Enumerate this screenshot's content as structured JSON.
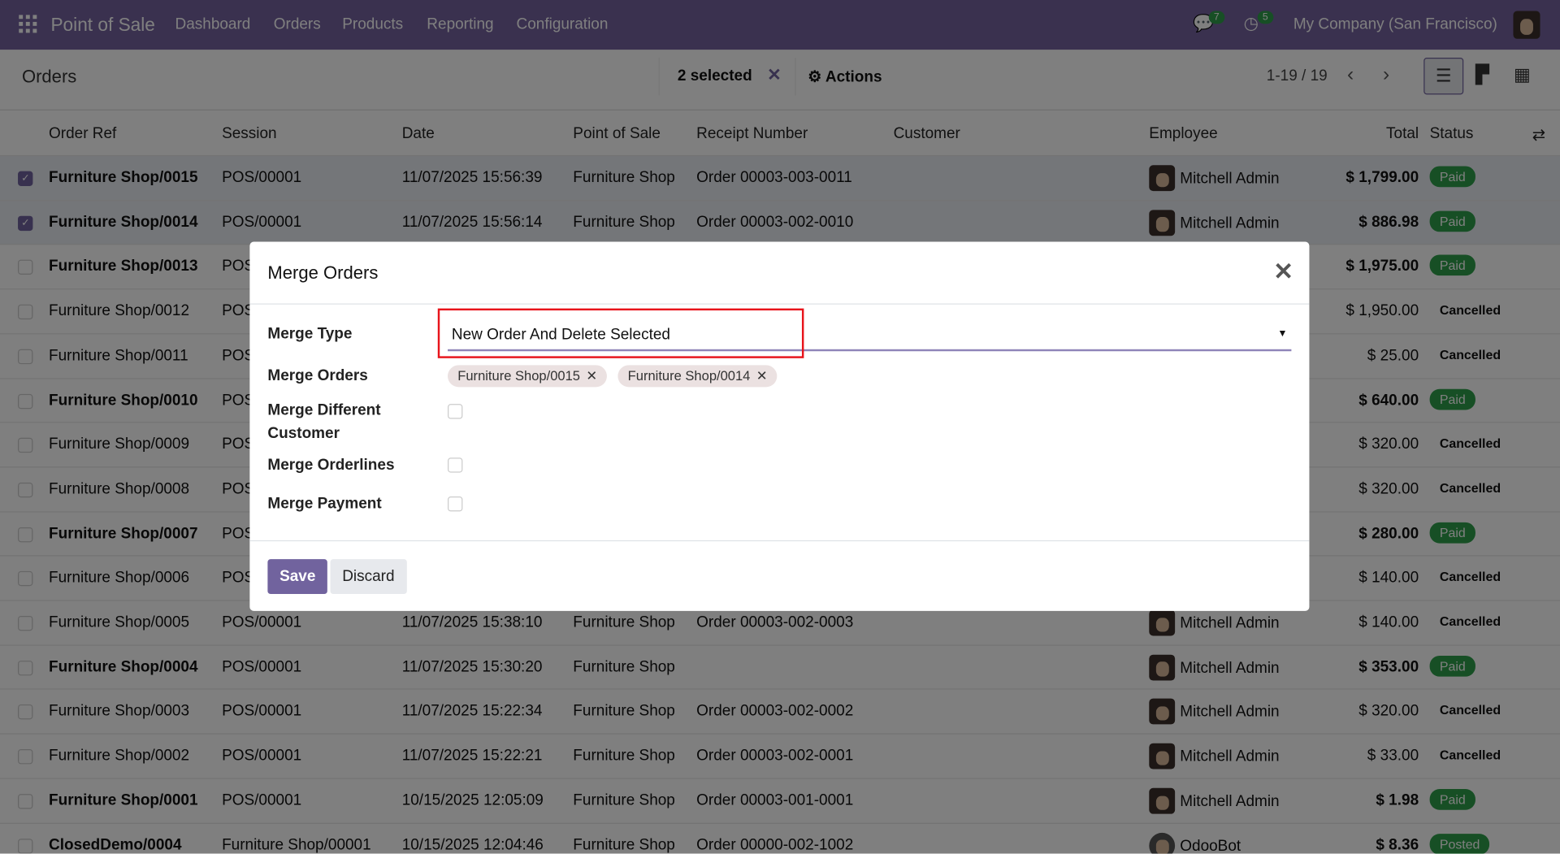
{
  "navbar": {
    "brand": "Point of Sale",
    "menu": [
      "Dashboard",
      "Orders",
      "Products",
      "Reporting",
      "Configuration"
    ],
    "messages_count": "7",
    "activities_count": "5",
    "company": "My Company (San Francisco)"
  },
  "control_panel": {
    "title": "Orders",
    "selected": "2 selected",
    "actions": "Actions",
    "pager": "1-19 / 19"
  },
  "columns": [
    "Order Ref",
    "Session",
    "Date",
    "Point of Sale",
    "Receipt Number",
    "Customer",
    "Employee",
    "Total",
    "Status"
  ],
  "rows": [
    {
      "ref": "Furniture Shop/0015",
      "session": "POS/00001",
      "date": "11/07/2025 15:56:39",
      "pos": "Furniture Shop",
      "receipt": "Order 00003-003-0011",
      "employee": "Mitchell Admin",
      "total": "$ 1,799.00",
      "status": "Paid",
      "checked": true
    },
    {
      "ref": "Furniture Shop/0014",
      "session": "POS/00001",
      "date": "11/07/2025 15:56:14",
      "pos": "Furniture Shop",
      "receipt": "Order 00003-002-0010",
      "employee": "Mitchell Admin",
      "total": "$ 886.98",
      "status": "Paid",
      "checked": true
    },
    {
      "ref": "Furniture Shop/0013",
      "session": "POS",
      "total": "$ 1,975.00",
      "status": "Paid"
    },
    {
      "ref": "Furniture Shop/0012",
      "session": "POS",
      "total": "$ 1,950.00",
      "status": "Cancelled"
    },
    {
      "ref": "Furniture Shop/0011",
      "session": "POS",
      "total": "$ 25.00",
      "status": "Cancelled"
    },
    {
      "ref": "Furniture Shop/0010",
      "session": "POS",
      "total": "$ 640.00",
      "status": "Paid"
    },
    {
      "ref": "Furniture Shop/0009",
      "session": "POS",
      "total": "$ 320.00",
      "status": "Cancelled"
    },
    {
      "ref": "Furniture Shop/0008",
      "session": "POS",
      "total": "$ 320.00",
      "status": "Cancelled"
    },
    {
      "ref": "Furniture Shop/0007",
      "session": "POS",
      "total": "$ 280.00",
      "status": "Paid"
    },
    {
      "ref": "Furniture Shop/0006",
      "session": "POS",
      "total": "$ 140.00",
      "status": "Cancelled"
    },
    {
      "ref": "Furniture Shop/0005",
      "session": "POS/00001",
      "date": "11/07/2025 15:38:10",
      "pos": "Furniture Shop",
      "receipt": "Order 00003-002-0003",
      "employee": "Mitchell Admin",
      "total": "$ 140.00",
      "status": "Cancelled"
    },
    {
      "ref": "Furniture Shop/0004",
      "session": "POS/00001",
      "date": "11/07/2025 15:30:20",
      "pos": "Furniture Shop",
      "receipt": "",
      "employee": "Mitchell Admin",
      "total": "$ 353.00",
      "status": "Paid"
    },
    {
      "ref": "Furniture Shop/0003",
      "session": "POS/00001",
      "date": "11/07/2025 15:22:34",
      "pos": "Furniture Shop",
      "receipt": "Order 00003-002-0002",
      "employee": "Mitchell Admin",
      "total": "$ 320.00",
      "status": "Cancelled"
    },
    {
      "ref": "Furniture Shop/0002",
      "session": "POS/00001",
      "date": "11/07/2025 15:22:21",
      "pos": "Furniture Shop",
      "receipt": "Order 00003-002-0001",
      "employee": "Mitchell Admin",
      "total": "$ 33.00",
      "status": "Cancelled"
    },
    {
      "ref": "Furniture Shop/0001",
      "session": "POS/00001",
      "date": "10/15/2025 12:05:09",
      "pos": "Furniture Shop",
      "receipt": "Order 00003-001-0001",
      "employee": "Mitchell Admin",
      "total": "$ 1.98",
      "status": "Paid"
    },
    {
      "ref": "ClosedDemo/0004",
      "session": "Furniture Shop/00001",
      "date": "10/15/2025 12:04:46",
      "pos": "Furniture Shop",
      "receipt": "Order 00000-002-1002",
      "employee": "OdooBot",
      "total": "$ 8.36",
      "status": "Posted"
    }
  ],
  "dialog": {
    "title": "Merge Orders",
    "merge_type_label": "Merge Type",
    "merge_type_value": "New Order And Delete Selected",
    "merge_orders_label": "Merge Orders",
    "tags": [
      "Furniture Shop/0015",
      "Furniture Shop/0014"
    ],
    "merge_different_customer_label": "Merge Different Customer",
    "merge_orderlines_label": "Merge Orderlines",
    "merge_payment_label": "Merge Payment",
    "save": "Save",
    "discard": "Discard"
  },
  "colors": {
    "accent": "#71639e",
    "success": "#2f9e4a",
    "highlight": "#e8141b"
  }
}
